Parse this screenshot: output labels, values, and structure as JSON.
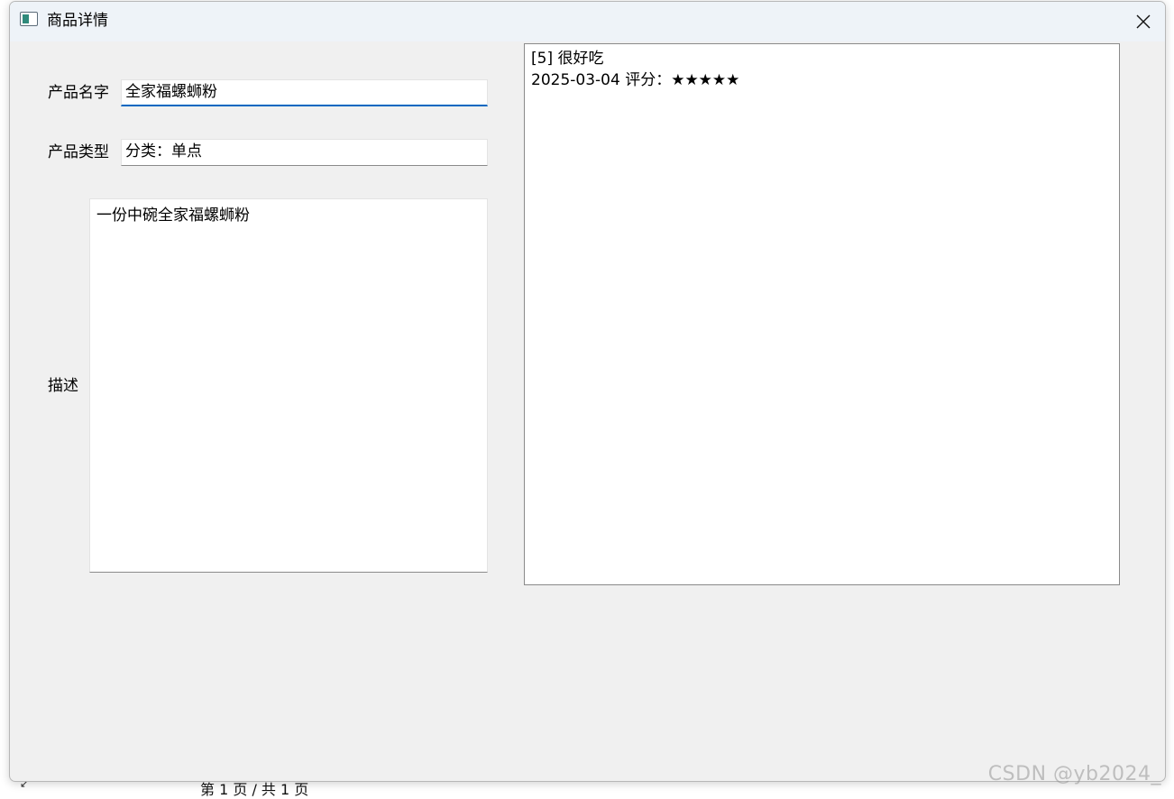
{
  "window": {
    "title": "商品详情",
    "icon": "app-window-icon",
    "close_icon": "close-icon"
  },
  "form": {
    "name_label": "产品名字",
    "name_value": "全家福螺蛳粉",
    "type_label": "产品类型",
    "type_value": "分类：单点",
    "desc_label": "描述",
    "desc_value": "一份中碗全家福螺蛳粉"
  },
  "reviews": [
    {
      "header": "[5] 很好吃",
      "meta": "2025-03-04 评分：★★★★★"
    }
  ],
  "background": {
    "pager_text": "第 1 页 / 共 1 页"
  },
  "watermark": "CSDN @yb2024_",
  "colors": {
    "focus_accent": "#0067c0",
    "window_bg": "#f0f0f0",
    "titlebar_bg": "#eef3f8"
  }
}
